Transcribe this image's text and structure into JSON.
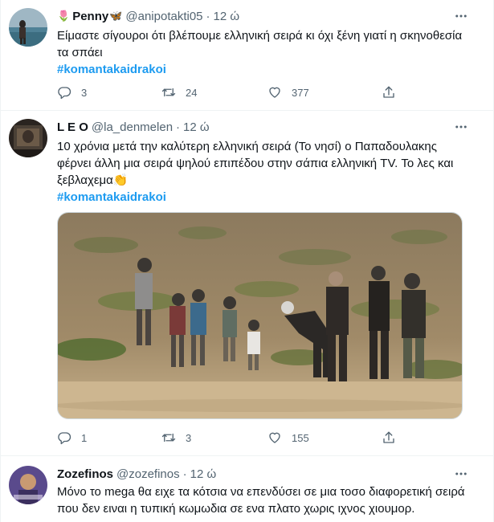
{
  "tweets": [
    {
      "name": "Penny",
      "name_emoji_1": "🌷",
      "name_emoji_2": "🦋",
      "handle": "@anipotakti05",
      "dot": "·",
      "time": "12 ώ",
      "text": "Είμαστε σίγουροι ότι βλέπουμε ελληνική σειρά κι όχι ξένη γιατί η σκηνοθεσία τα σπάει",
      "hashtag": "#komantakaidrakoi",
      "replies": "3",
      "retweets": "24",
      "likes": "377"
    },
    {
      "name": "L E O",
      "handle": "@la_denmelen",
      "dot": "·",
      "time": "12 ώ",
      "text": "10 χρόνια μετά την καλύτερη ελληνική σειρά (Το νησί) ο Παπαδουλακης φέρνει άλλη μια σειρά ψηλού επιπέδου στην σάπια ελληνική TV. Το λες και ξεβλαχεμα👏",
      "hashtag": "#komantakaidrakoi",
      "replies": "1",
      "retweets": "3",
      "likes": "155"
    },
    {
      "name": "Zozefinos",
      "handle": "@zozefinos",
      "dot": "·",
      "time": "12 ώ",
      "text": "Μόνο το mega θα ειχε τα κότσια να επενδύσει σε μια τοσο διαφορετική σειρά που δεν ειναι η τυπική κωμωδια σε ενα πλατο χωρις ιχνος χιουμορ."
    }
  ],
  "icons": {
    "more": "more-horizontal-icon",
    "reply": "reply-icon",
    "retweet": "retweet-icon",
    "like": "heart-icon",
    "share": "share-icon"
  },
  "colors": {
    "text": "#0f1419",
    "secondary": "#536471",
    "hashtag": "#1d9bf0",
    "divider": "#eff3f4"
  }
}
